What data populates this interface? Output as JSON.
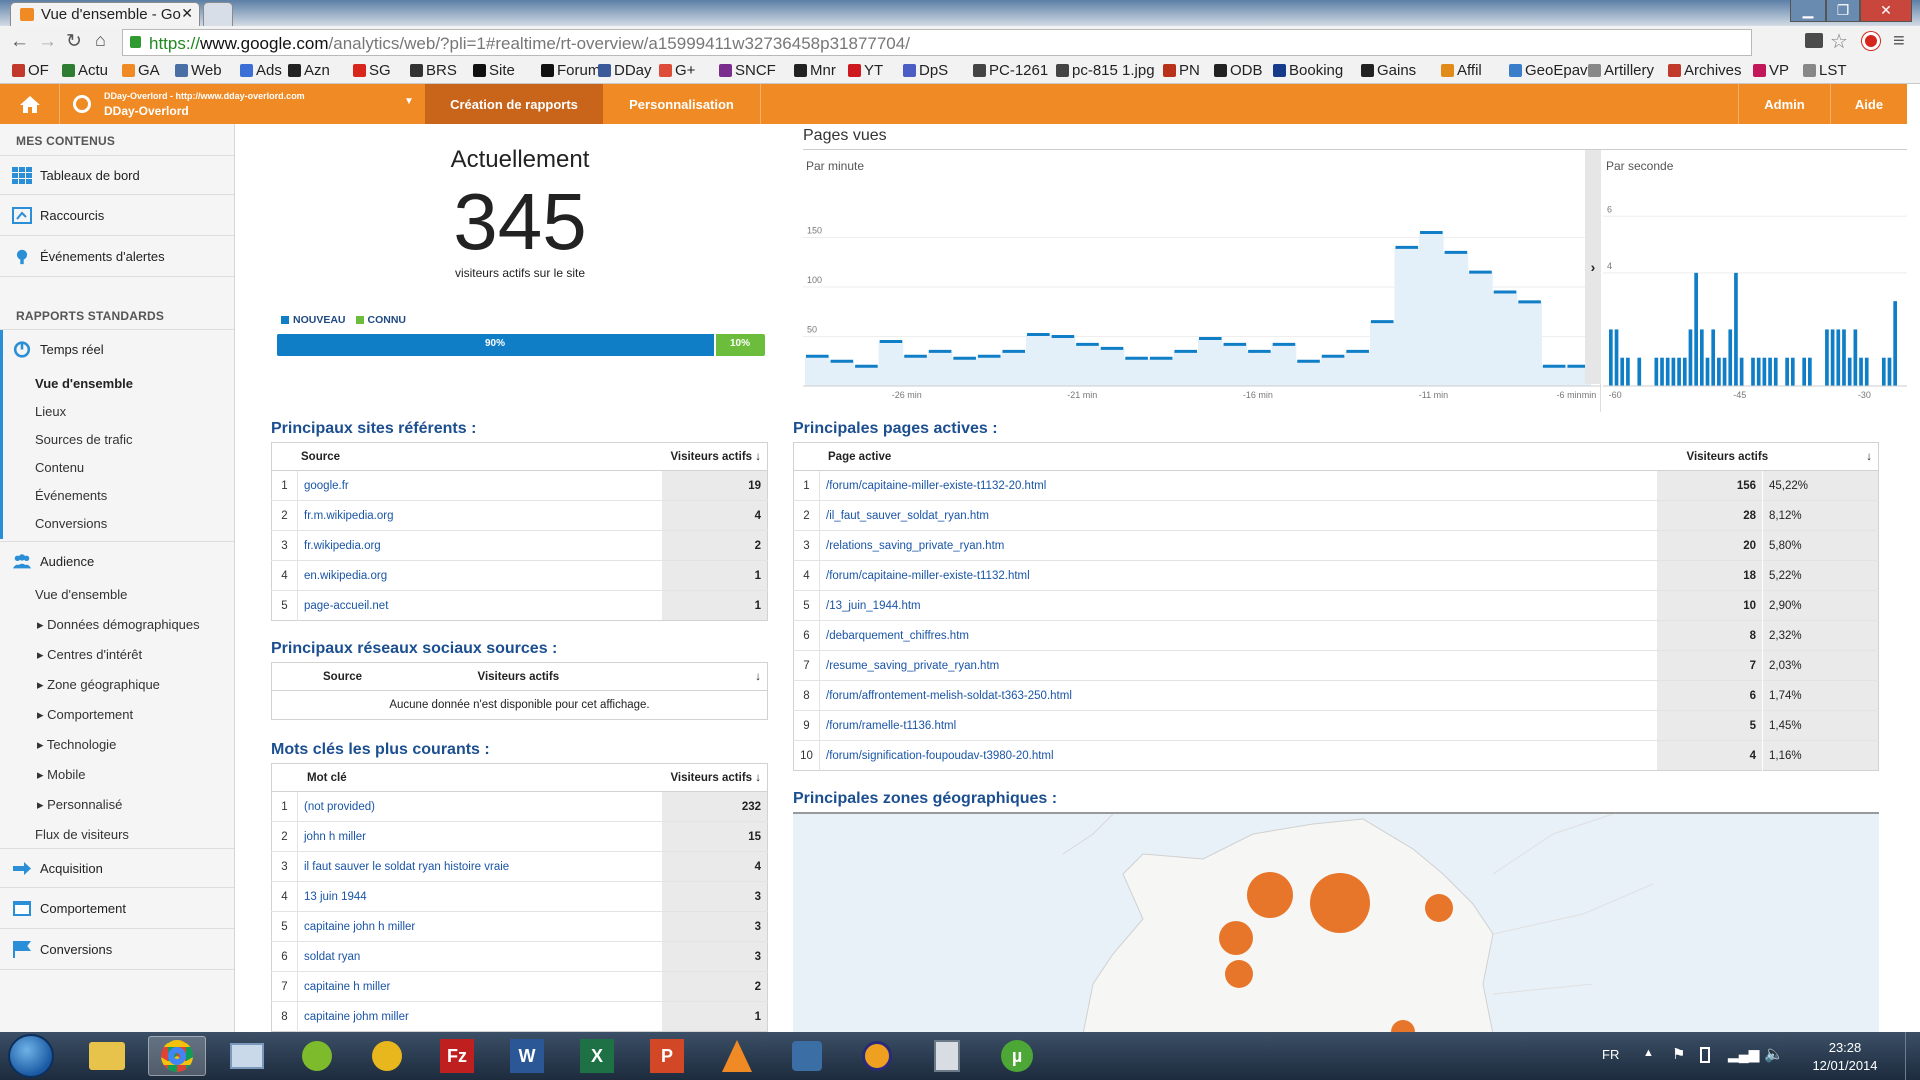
{
  "browser": {
    "tab_active": "Vue d'ensemble - Go",
    "url_prefix": "https://",
    "url_domain": "www.google.com",
    "url_rest": "/analytics/web/?pli=1#realtime/rt-overview/a15999411w32736458p31877704/",
    "bookmarks": [
      {
        "label": "OF",
        "icon_color": "#c0392b"
      },
      {
        "label": "Actu",
        "icon_color": "#2e7d32"
      },
      {
        "label": "GA",
        "icon_color": "#f08a24"
      },
      {
        "label": "Web",
        "icon_color": "#4a6fa5"
      },
      {
        "label": "Ads",
        "icon_color": "#3b6fd6"
      },
      {
        "label": "Azn",
        "icon_color": "#222222"
      },
      {
        "label": "SG",
        "icon_color": "#d9261c"
      },
      {
        "label": "BRS",
        "icon_color": "#333333"
      },
      {
        "label": "Site",
        "icon_color": "#111111"
      },
      {
        "label": "Forum",
        "icon_color": "#111111"
      },
      {
        "label": "DDay",
        "icon_color": "#3b5998"
      },
      {
        "label": "G+",
        "icon_color": "#dd4b39"
      },
      {
        "label": "SNCF",
        "icon_color": "#7b2d8e"
      },
      {
        "label": "Mnr",
        "icon_color": "#222222"
      },
      {
        "label": "YT",
        "icon_color": "#cc181e"
      },
      {
        "label": "DpS",
        "icon_color": "#4b5cc4"
      },
      {
        "label": "PC-1261",
        "icon_color": "#444444"
      },
      {
        "label": "pc-815 1.jpg",
        "icon_color": "#444444"
      },
      {
        "label": "PN",
        "icon_color": "#b8321a"
      },
      {
        "label": "ODB",
        "icon_color": "#222222"
      },
      {
        "label": "Booking",
        "icon_color": "#163b8b"
      },
      {
        "label": "Gains",
        "icon_color": "#222222"
      },
      {
        "label": "Affil",
        "icon_color": "#e08b1a"
      },
      {
        "label": "GeoEpav",
        "icon_color": "#3a7dc9"
      },
      {
        "label": "Artillery",
        "icon_color": "#888888"
      },
      {
        "label": "Archives",
        "icon_color": "#c0392b"
      },
      {
        "label": "VP",
        "icon_color": "#c2185b"
      },
      {
        "label": "LST",
        "icon_color": "#888888"
      }
    ]
  },
  "ga_nav": {
    "account_url": "DDay-Overlord - http://www.dday-overlord.com",
    "account_name": "DDay-Overlord",
    "reports": "Création de rapports",
    "custom": "Personnalisation",
    "admin": "Admin",
    "help": "Aide"
  },
  "sidebar": {
    "my_content": "MES CONTENUS",
    "dashboards": "Tableaux de bord",
    "shortcuts": "Raccourcis",
    "alerts": "Événements d'alertes",
    "standard": "RAPPORTS STANDARDS",
    "realtime": "Temps réel",
    "realtime_items": [
      "Vue d'ensemble",
      "Lieux",
      "Sources de trafic",
      "Contenu",
      "Événements",
      "Conversions"
    ],
    "audience": "Audience",
    "audience_items": [
      "Vue d'ensemble",
      "Données démographiques",
      "Centres d'intérêt",
      "Zone géographique",
      "Comportement",
      "Technologie",
      "Mobile",
      "Personnalisé",
      "Flux de visiteurs"
    ],
    "acquisition": "Acquisition",
    "behavior": "Comportement",
    "conversions": "Conversions"
  },
  "now": {
    "title": "Actuellement",
    "count": "345",
    "subtitle": "visiteurs actifs sur le site",
    "legend_new": "NOUVEAU",
    "legend_returning": "CONNU",
    "new_pct": "90%",
    "returning_pct": "10%",
    "new_fraction": 0.9
  },
  "pageviews": {
    "title": "Pages vues",
    "per_minute": "Par minute",
    "per_second": "Par seconde"
  },
  "chart_data": [
    {
      "type": "area",
      "title": "Par minute",
      "ylim": [
        0,
        200
      ],
      "yticks": [
        50,
        100,
        150
      ],
      "xticks": [
        "-26 min",
        "-21 min",
        "-16 min",
        "-11 min",
        "-6 min",
        "min"
      ],
      "values": [
        30,
        25,
        20,
        45,
        30,
        35,
        28,
        30,
        35,
        52,
        50,
        42,
        38,
        28,
        28,
        35,
        48,
        42,
        35,
        42,
        25,
        30,
        35,
        65,
        140,
        155,
        135,
        115,
        95,
        85,
        20,
        20
      ]
    },
    {
      "type": "bar",
      "title": "Par seconde",
      "ylim": [
        0,
        7
      ],
      "yticks": [
        4,
        6
      ],
      "xticks": [
        "-60",
        "-45",
        "-30"
      ],
      "values": [
        2,
        2,
        1,
        1,
        0,
        1,
        0,
        0,
        1,
        1,
        1,
        1,
        1,
        1,
        2,
        4,
        2,
        1,
        2,
        1,
        1,
        2,
        4,
        1,
        0,
        1,
        1,
        1,
        1,
        1,
        0,
        1,
        1,
        0,
        1,
        1,
        0,
        0,
        2,
        2,
        2,
        2,
        1,
        2,
        1,
        1,
        0,
        0,
        1,
        1,
        3
      ]
    }
  ],
  "referrers": {
    "title": "Principaux sites référents :",
    "col_source": "Source",
    "col_visitors": "Visiteurs actifs",
    "rows": [
      {
        "n": "1",
        "label": "google.fr",
        "value": "19"
      },
      {
        "n": "2",
        "label": "fr.m.wikipedia.org",
        "value": "4"
      },
      {
        "n": "3",
        "label": "fr.wikipedia.org",
        "value": "2"
      },
      {
        "n": "4",
        "label": "en.wikipedia.org",
        "value": "1"
      },
      {
        "n": "5",
        "label": "page-accueil.net",
        "value": "1"
      }
    ]
  },
  "social": {
    "title": "Principaux réseaux sociaux sources :",
    "col_source": "Source",
    "col_visitors": "Visiteurs actifs",
    "empty": "Aucune donnée n'est disponible pour cet affichage."
  },
  "keywords": {
    "title": "Mots clés les plus courants :",
    "col_keyword": "Mot clé",
    "col_visitors": "Visiteurs actifs",
    "rows": [
      {
        "n": "1",
        "label": "(not provided)",
        "value": "232"
      },
      {
        "n": "2",
        "label": "john h miller",
        "value": "15"
      },
      {
        "n": "3",
        "label": "il faut sauver le soldat ryan histoire vraie",
        "value": "4"
      },
      {
        "n": "4",
        "label": "13 juin 1944",
        "value": "3"
      },
      {
        "n": "5",
        "label": "capitaine john h miller",
        "value": "3"
      },
      {
        "n": "6",
        "label": "soldat ryan",
        "value": "3"
      },
      {
        "n": "7",
        "label": "capitaine h miller",
        "value": "2"
      },
      {
        "n": "8",
        "label": "capitaine johm miller",
        "value": "1"
      }
    ]
  },
  "pages": {
    "title": "Principales pages actives :",
    "col_page": "Page active",
    "col_visitors": "Visiteurs actifs",
    "rows": [
      {
        "n": "1",
        "label": "/forum/capitaine-miller-existe-t1132-20.html",
        "value": "156",
        "pct": "45,22%"
      },
      {
        "n": "2",
        "label": "/il_faut_sauver_soldat_ryan.htm",
        "value": "28",
        "pct": "8,12%"
      },
      {
        "n": "3",
        "label": "/relations_saving_private_ryan.htm",
        "value": "20",
        "pct": "5,80%"
      },
      {
        "n": "4",
        "label": "/forum/capitaine-miller-existe-t1132.html",
        "value": "18",
        "pct": "5,22%"
      },
      {
        "n": "5",
        "label": "/13_juin_1944.htm",
        "value": "10",
        "pct": "2,90%"
      },
      {
        "n": "6",
        "label": "/debarquement_chiffres.htm",
        "value": "8",
        "pct": "2,32%"
      },
      {
        "n": "7",
        "label": "/resume_saving_private_ryan.htm",
        "value": "7",
        "pct": "2,03%"
      },
      {
        "n": "8",
        "label": "/forum/affrontement-melish-soldat-t363-250.html",
        "value": "6",
        "pct": "1,74%"
      },
      {
        "n": "9",
        "label": "/forum/ramelle-t1136.html",
        "value": "5",
        "pct": "1,45%"
      },
      {
        "n": "10",
        "label": "/forum/signification-foupoudav-t3980-20.html",
        "value": "4",
        "pct": "1,16%"
      }
    ]
  },
  "geo": {
    "title": "Principales zones géographiques :"
  },
  "taskbar": {
    "lang": "FR",
    "time": "23:28",
    "date": "12/01/2014"
  },
  "colors": {
    "ga_orange": "#f08a24",
    "new_blue": "#0f7ec6",
    "returning_green": "#6cbd3b",
    "bubble_orange": "#e8762a"
  }
}
